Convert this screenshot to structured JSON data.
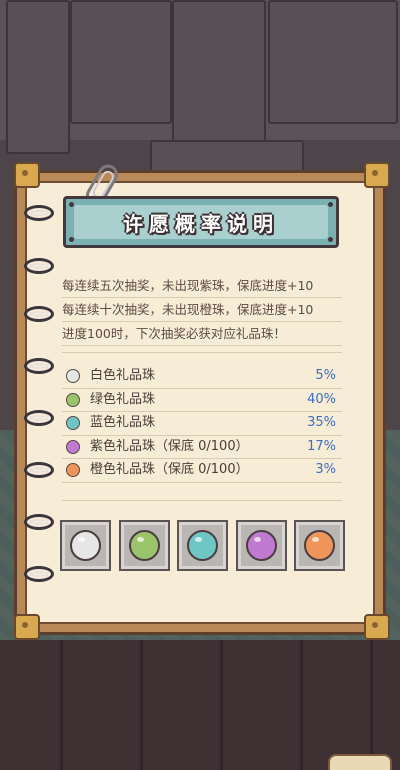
{
  "title": "许愿概率说明",
  "rules": [
    "每连续五次抽奖，未出现紫珠，保底进度+10",
    "每连续十次抽奖，未出现橙珠，保底进度+10",
    "进度100时，下次抽奖必获对应礼品珠！"
  ],
  "pearls": [
    {
      "name": "白色礼品珠",
      "rate": "5%",
      "color": "#e6e6e6"
    },
    {
      "name": "绿色礼品珠",
      "rate": "40%",
      "color": "#9bc46a"
    },
    {
      "name": "蓝色礼品珠",
      "rate": "35%",
      "color": "#6ec7c4"
    },
    {
      "name": "紫色礼品珠（保底 0/100）",
      "rate": "17%",
      "color": "#c07ad0"
    },
    {
      "name": "橙色礼品珠（保底 0/100）",
      "rate": "3%",
      "color": "#f0955a"
    }
  ],
  "colors": {
    "rate_text": "#3b6fc4",
    "banner": "#7bb1b2"
  }
}
